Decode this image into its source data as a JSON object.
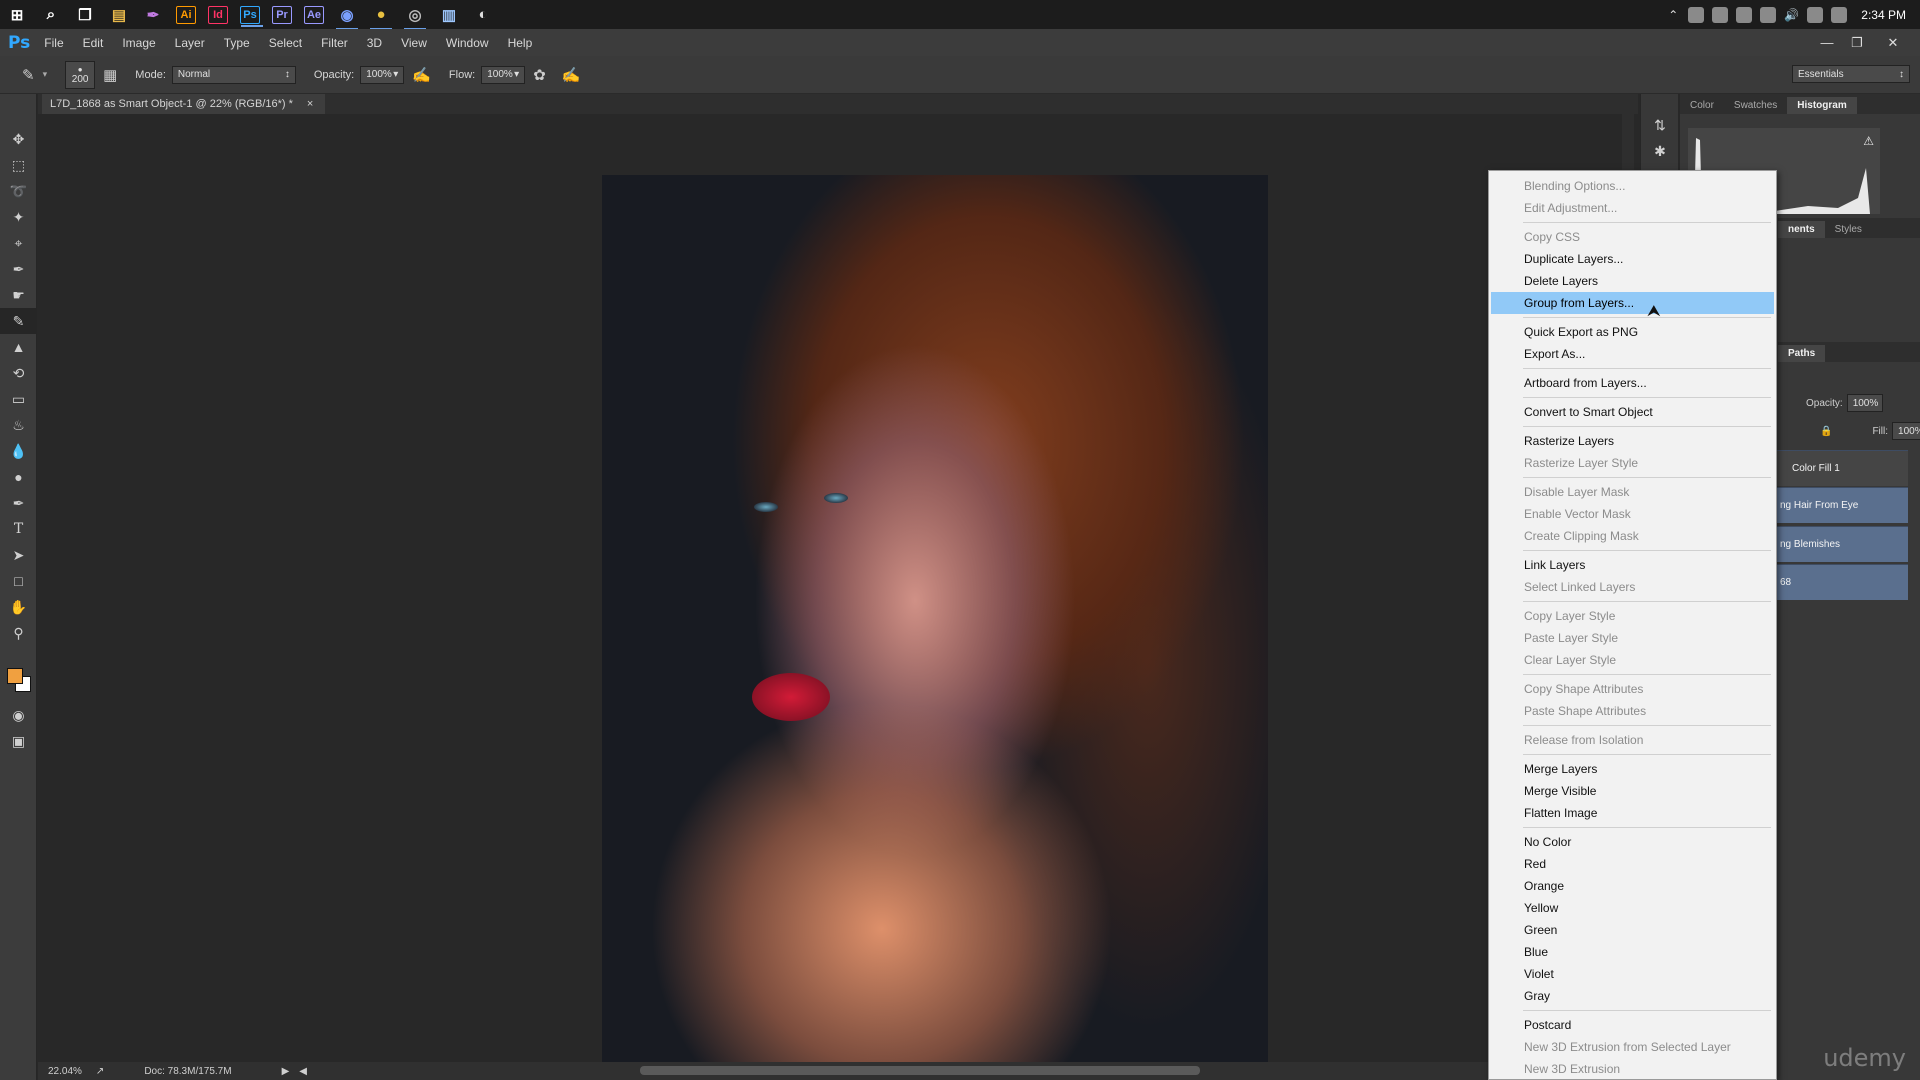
{
  "taskbar": {
    "apps": [
      {
        "name": "start-icon",
        "glyph": "⊞",
        "color": "#ffffff"
      },
      {
        "name": "search-icon",
        "glyph": "⌕",
        "color": "#ffffff"
      },
      {
        "name": "task-view-icon",
        "glyph": "❐",
        "color": "#ffffff"
      },
      {
        "name": "file-explorer-icon",
        "glyph": "▤",
        "color": "#e8b84a"
      },
      {
        "name": "pen-app-icon",
        "glyph": "✒",
        "color": "#c07ae0"
      },
      {
        "name": "illustrator-icon",
        "glyph": "Ai",
        "color": "#ff9a00"
      },
      {
        "name": "indesign-icon",
        "glyph": "Id",
        "color": "#ff3366"
      },
      {
        "name": "photoshop-icon",
        "glyph": "Ps",
        "color": "#31a8ff"
      },
      {
        "name": "premiere-icon",
        "glyph": "Pr",
        "color": "#9999ff"
      },
      {
        "name": "after-effects-icon",
        "glyph": "Ae",
        "color": "#9999ff"
      },
      {
        "name": "app-circle-icon",
        "glyph": "◉",
        "color": "#7aa0ff"
      },
      {
        "name": "chrome-icon",
        "glyph": "●",
        "color": "#e8c040"
      },
      {
        "name": "app-globe-icon",
        "glyph": "◎",
        "color": "#bbbbbb"
      },
      {
        "name": "notes-app-icon",
        "glyph": "▥",
        "color": "#9ec8ff"
      },
      {
        "name": "app-disc-icon",
        "glyph": "◐",
        "color": "#dddddd"
      }
    ],
    "clock": "2:34 PM"
  },
  "menubar": {
    "logo": "Ps",
    "items": [
      "File",
      "Edit",
      "Image",
      "Layer",
      "Type",
      "Select",
      "Filter",
      "3D",
      "View",
      "Window",
      "Help"
    ]
  },
  "options": {
    "brush_size": "200",
    "mode_label": "Mode:",
    "mode_value": "Normal",
    "opacity_label": "Opacity:",
    "opacity_value": "100%",
    "flow_label": "Flow:",
    "flow_value": "100%",
    "workspace": "Essentials"
  },
  "document": {
    "tab_title": "L7D_1868 as Smart Object-1 @ 22% (RGB/16*) *",
    "zoom": "22.04%",
    "doc_size": "Doc: 78.3M/175.7M"
  },
  "panels": {
    "top_tabs": [
      "Color",
      "Swatches",
      "Histogram"
    ],
    "mid_tabs": [
      "nents",
      "Styles"
    ],
    "paths_tab": "Paths",
    "opacity_label": "Opacity:",
    "opacity_value": "100%",
    "fill_label": "Fill:",
    "fill_value": "100%",
    "layers": [
      "Color Fill 1",
      "ng Hair From Eye",
      "ng Blemishes",
      "68"
    ]
  },
  "context_menu": {
    "groups": [
      [
        {
          "label": "Blending Options...",
          "enabled": false
        },
        {
          "label": "Edit Adjustment...",
          "enabled": false
        }
      ],
      [
        {
          "label": "Copy CSS",
          "enabled": false
        },
        {
          "label": "Duplicate Layers...",
          "enabled": true
        },
        {
          "label": "Delete Layers",
          "enabled": true
        },
        {
          "label": "Group from Layers...",
          "enabled": true,
          "highlighted": true
        }
      ],
      [
        {
          "label": "Quick Export as PNG",
          "enabled": true
        },
        {
          "label": "Export As...",
          "enabled": true
        }
      ],
      [
        {
          "label": "Artboard from Layers...",
          "enabled": true
        }
      ],
      [
        {
          "label": "Convert to Smart Object",
          "enabled": true
        }
      ],
      [
        {
          "label": "Rasterize Layers",
          "enabled": true
        },
        {
          "label": "Rasterize Layer Style",
          "enabled": false
        }
      ],
      [
        {
          "label": "Disable Layer Mask",
          "enabled": false
        },
        {
          "label": "Enable Vector Mask",
          "enabled": false
        },
        {
          "label": "Create Clipping Mask",
          "enabled": false
        }
      ],
      [
        {
          "label": "Link Layers",
          "enabled": true
        },
        {
          "label": "Select Linked Layers",
          "enabled": false
        }
      ],
      [
        {
          "label": "Copy Layer Style",
          "enabled": false
        },
        {
          "label": "Paste Layer Style",
          "enabled": false
        },
        {
          "label": "Clear Layer Style",
          "enabled": false
        }
      ],
      [
        {
          "label": "Copy Shape Attributes",
          "enabled": false
        },
        {
          "label": "Paste Shape Attributes",
          "enabled": false
        }
      ],
      [
        {
          "label": "Release from Isolation",
          "enabled": false
        }
      ],
      [
        {
          "label": "Merge Layers",
          "enabled": true
        },
        {
          "label": "Merge Visible",
          "enabled": true
        },
        {
          "label": "Flatten Image",
          "enabled": true
        }
      ],
      [
        {
          "label": "No Color",
          "enabled": true
        },
        {
          "label": "Red",
          "enabled": true
        },
        {
          "label": "Orange",
          "enabled": true
        },
        {
          "label": "Yellow",
          "enabled": true
        },
        {
          "label": "Green",
          "enabled": true
        },
        {
          "label": "Blue",
          "enabled": true
        },
        {
          "label": "Violet",
          "enabled": true
        },
        {
          "label": "Gray",
          "enabled": true
        }
      ],
      [
        {
          "label": "Postcard",
          "enabled": true
        },
        {
          "label": "New 3D Extrusion from Selected Layer",
          "enabled": false
        },
        {
          "label": "New 3D Extrusion",
          "enabled": false
        }
      ]
    ]
  },
  "watermark": "udemy",
  "colors": {
    "foreground": "#f0a040",
    "background": "#ffffff",
    "highlight": "#91c9f7",
    "ps_blue": "#31a8ff"
  }
}
